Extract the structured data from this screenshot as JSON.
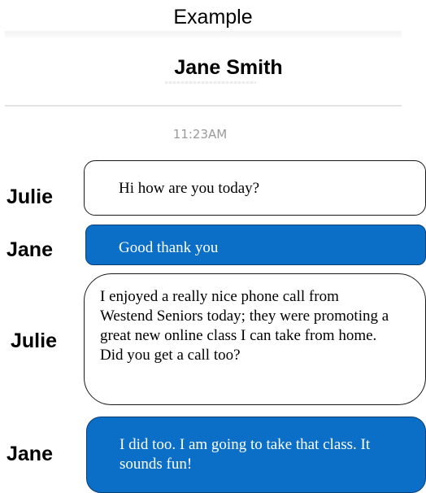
{
  "header": {
    "title": "Example",
    "contact_name": "Jane Smith"
  },
  "conversation": {
    "timestamp": "11:23AM",
    "messages": [
      {
        "sender": "Julie",
        "direction": "incoming",
        "text": "Hi how are you today?"
      },
      {
        "sender": "Jane",
        "direction": "outgoing",
        "text": "Good thank you"
      },
      {
        "sender": "Julie",
        "direction": "incoming",
        "text": "I enjoyed a really nice phone call from Westend Seniors today; they were promoting a great new online class I can take from home. Did you get a call too?"
      },
      {
        "sender": "Jane",
        "direction": "outgoing",
        "text": "I did too. I am going to take that class. It sounds fun!"
      }
    ]
  },
  "colors": {
    "outgoing_bubble": "#0b6ec7",
    "incoming_bubble": "#ffffff",
    "timestamp_text": "#9a9a9a"
  }
}
